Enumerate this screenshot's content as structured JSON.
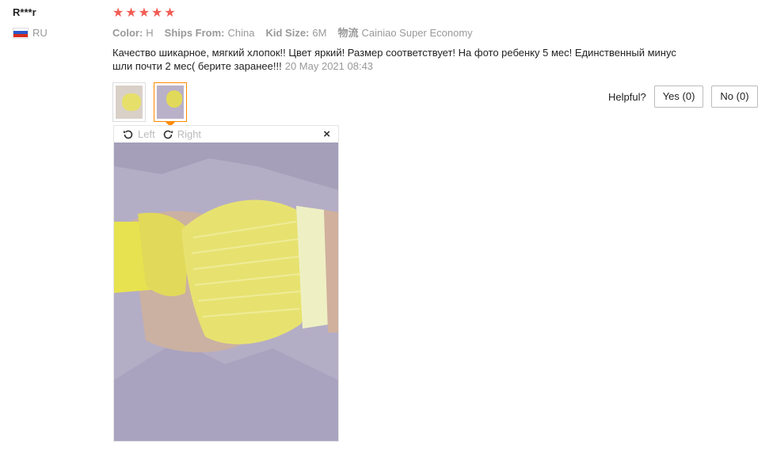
{
  "user": {
    "name": "R***r",
    "country": "RU"
  },
  "review": {
    "stars": 5,
    "meta": {
      "color_label": "Color:",
      "color_value": "H",
      "ships_label": "Ships From:",
      "ships_value": "China",
      "kid_size_label": "Kid Size:",
      "kid_size_value": "6M",
      "logistics_label": "物流",
      "logistics_value": "Cainiao Super Economy"
    },
    "text": "Качество шикарное, мягкий хлопок!! Цвет яркий! Размер соответствует! На фото ребенку 5 мес! Единственный минус шли почти 2 мес( берите заранее!!!",
    "date": "20 May 2021 08:43"
  },
  "viewer": {
    "rotate_left": "Left",
    "rotate_right": "Right",
    "close": "×"
  },
  "helpful": {
    "label": "Helpful?",
    "yes": "Yes (0)",
    "no": "No (0)"
  },
  "colors": {
    "star": "#f25c54",
    "accent": "#ff8a00"
  }
}
